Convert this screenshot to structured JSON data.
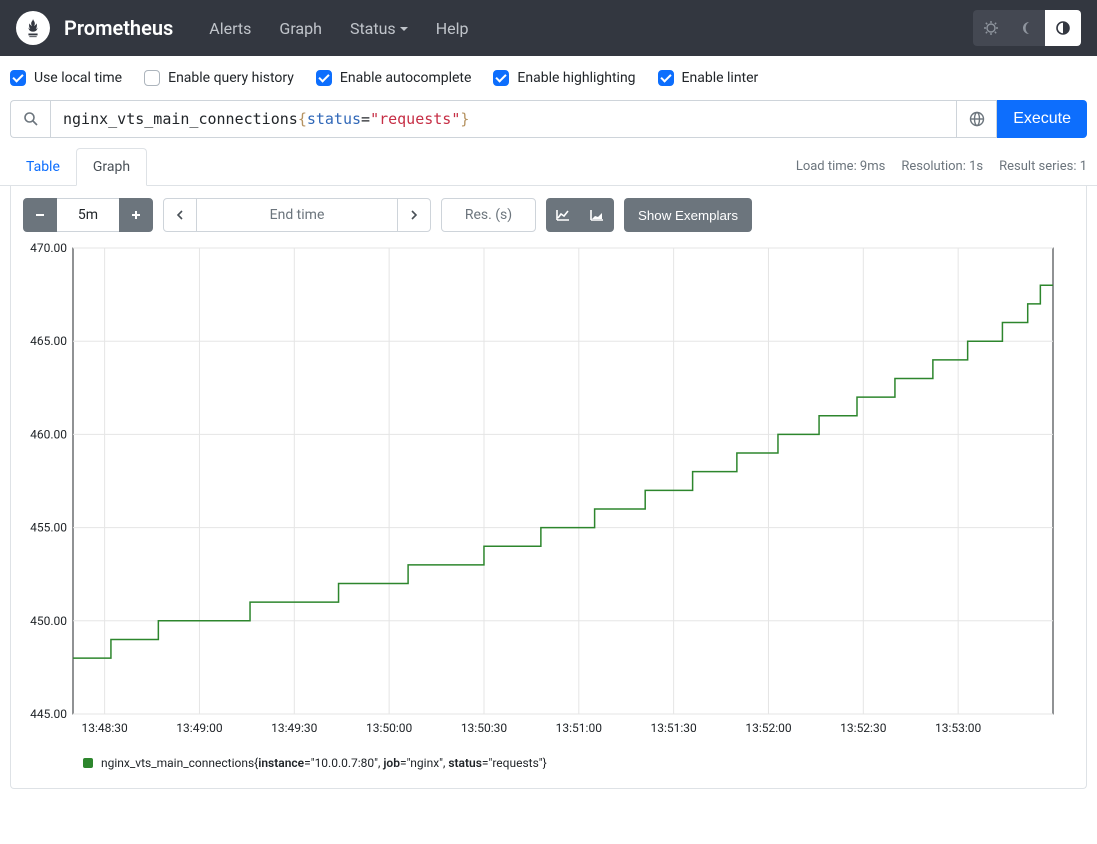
{
  "navbar": {
    "brand": "Prometheus",
    "links": [
      "Alerts",
      "Graph",
      "Status",
      "Help"
    ]
  },
  "options": {
    "local_time": "Use local time",
    "query_history": "Enable query history",
    "autocomplete": "Enable autocomplete",
    "highlighting": "Enable highlighting",
    "linter": "Enable linter"
  },
  "query": {
    "metric": "nginx_vts_main_connections",
    "label_key": "status",
    "label_val": "\"requests\"",
    "execute": "Execute"
  },
  "tabs": {
    "table": "Table",
    "graph": "Graph"
  },
  "tab_meta": {
    "load_time": "Load time: 9ms",
    "resolution": "Resolution: 1s",
    "series": "Result series: 1"
  },
  "controls": {
    "range": "5m",
    "end_time_placeholder": "End time",
    "res_placeholder": "Res. (s)",
    "exemplars": "Show Exemplars"
  },
  "chart_data": {
    "type": "line",
    "ylim": [
      445,
      470
    ],
    "yticks": [
      445,
      450,
      455,
      460,
      465,
      470
    ],
    "xticks": [
      "13:48:30",
      "13:49:00",
      "13:49:30",
      "13:50:00",
      "13:50:30",
      "13:51:00",
      "13:51:30",
      "13:52:00",
      "13:52:30",
      "13:53:00"
    ],
    "x_start": 0,
    "x_end": 310,
    "x_tick_positions": [
      10,
      40,
      70,
      100,
      130,
      160,
      190,
      220,
      250,
      280
    ],
    "series": [
      {
        "name": "nginx_vts_main_connections",
        "labels": {
          "instance": "10.0.0.7:80",
          "job": "nginx",
          "status": "requests"
        },
        "color": "#2d862d",
        "points": [
          [
            0,
            448
          ],
          [
            12,
            448
          ],
          [
            12,
            449
          ],
          [
            27,
            449
          ],
          [
            27,
            450
          ],
          [
            42,
            450
          ],
          [
            42,
            450
          ],
          [
            56,
            450
          ],
          [
            56,
            451
          ],
          [
            70,
            451
          ],
          [
            70,
            451
          ],
          [
            84,
            451
          ],
          [
            84,
            452
          ],
          [
            95,
            452
          ],
          [
            95,
            452
          ],
          [
            106,
            452
          ],
          [
            106,
            453
          ],
          [
            118,
            453
          ],
          [
            118,
            453
          ],
          [
            130,
            453
          ],
          [
            130,
            454
          ],
          [
            138,
            454
          ],
          [
            138,
            454
          ],
          [
            148,
            454
          ],
          [
            148,
            455
          ],
          [
            156,
            455
          ],
          [
            156,
            455
          ],
          [
            165,
            455
          ],
          [
            165,
            456
          ],
          [
            172,
            456
          ],
          [
            172,
            456
          ],
          [
            181,
            456
          ],
          [
            181,
            457
          ],
          [
            188,
            457
          ],
          [
            188,
            457
          ],
          [
            196,
            457
          ],
          [
            196,
            458
          ],
          [
            202,
            458
          ],
          [
            202,
            458
          ],
          [
            210,
            458
          ],
          [
            210,
            459
          ],
          [
            216,
            459
          ],
          [
            216,
            459
          ],
          [
            223,
            459
          ],
          [
            223,
            460
          ],
          [
            228,
            460
          ],
          [
            228,
            460
          ],
          [
            236,
            460
          ],
          [
            236,
            461
          ],
          [
            241,
            461
          ],
          [
            241,
            461
          ],
          [
            248,
            461
          ],
          [
            248,
            462
          ],
          [
            253,
            462
          ],
          [
            253,
            462
          ],
          [
            260,
            462
          ],
          [
            260,
            463
          ],
          [
            265,
            463
          ],
          [
            265,
            463
          ],
          [
            272,
            463
          ],
          [
            272,
            464
          ],
          [
            277,
            464
          ],
          [
            277,
            464
          ],
          [
            283,
            464
          ],
          [
            283,
            465
          ],
          [
            288,
            465
          ],
          [
            288,
            465
          ],
          [
            294,
            465
          ],
          [
            294,
            466
          ],
          [
            298,
            466
          ],
          [
            298,
            466
          ],
          [
            302,
            466
          ],
          [
            302,
            467
          ],
          [
            306,
            467
          ],
          [
            306,
            468
          ],
          [
            310,
            468
          ]
        ]
      }
    ]
  },
  "legend": {
    "metric": "nginx_vts_main_connections",
    "k1": "instance",
    "v1": "\"10.0.0.7:80\"",
    "k2": "job",
    "v2": "\"nginx\"",
    "k3": "status",
    "v3": "\"requests\""
  }
}
